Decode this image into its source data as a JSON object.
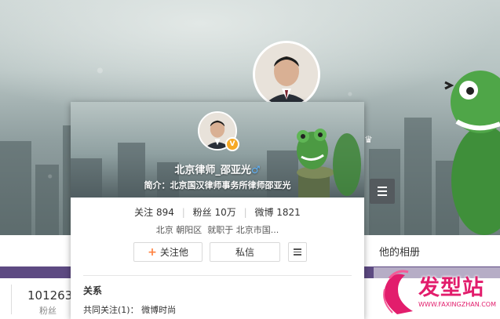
{
  "cover": {
    "nav_albums": "他的相册"
  },
  "stats": {
    "number": "101263",
    "label": "粉丝"
  },
  "card": {
    "name": "北京律师_邵亚光",
    "gender_icon": "male-icon",
    "verified_icon": "verified-v-icon",
    "verified_letter": "V",
    "bio_label": "简介：",
    "bio_text": "北京国汉律师事务所律师邵亚光",
    "follow_label": "关注",
    "follow_count": "894",
    "fans_label": "粉丝",
    "fans_count": "10万",
    "weibo_label": "微博",
    "weibo_count": "1821",
    "location": "北京 朝阳区",
    "employer": "就职于 北京市国...",
    "follow_button": "关注他",
    "message_button": "私信",
    "relation_title": "关系",
    "common_follow": "共同关注(1)： 微博时尚"
  },
  "watermark": {
    "text": "发型站",
    "url": "WWW.FAXINGZHAN.COM"
  },
  "colors": {
    "accent_orange": "#ff8140",
    "purple_bar": "#5d4a82",
    "watermark_pink": "#e21d6c",
    "verified_gold": "#f6a925"
  }
}
